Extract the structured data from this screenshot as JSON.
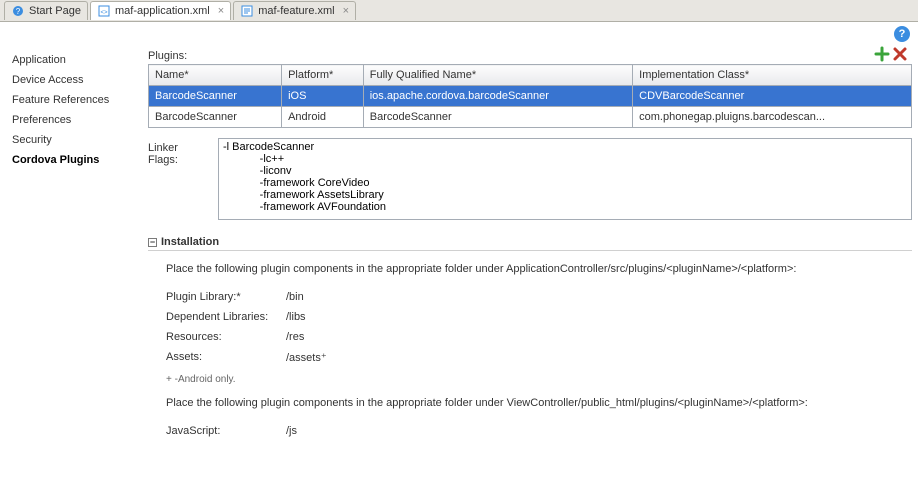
{
  "tabs": [
    {
      "label": "Start Page",
      "icon": "question"
    },
    {
      "label": "maf-application.xml",
      "icon": "xml-app"
    },
    {
      "label": "maf-feature.xml",
      "icon": "xml-feat"
    }
  ],
  "side_nav": {
    "items": [
      "Application",
      "Device Access",
      "Feature References",
      "Preferences",
      "Security",
      "Cordova Plugins"
    ],
    "active_index": 5
  },
  "plugins": {
    "label": "Plugins:",
    "columns": [
      "Name*",
      "Platform*",
      "Fully Qualified Name*",
      "Implementation Class*"
    ],
    "rows": [
      {
        "name": "BarcodeScanner",
        "platform": "iOS",
        "fqn": "ios.apache.cordova.barcodeScanner",
        "impl": "CDVBarcodeScanner",
        "selected": true
      },
      {
        "name": "BarcodeScanner",
        "platform": "Android",
        "fqn": "BarcodeScanner",
        "impl": "com.phonegap.pluigns.barcodescan...",
        "selected": false
      }
    ]
  },
  "linker": {
    "label": "Linker Flags:",
    "value": "-l BarcodeScanner\n            -lc++\n            -liconv\n            -framework CoreVideo\n            -framework AssetsLibrary\n            -framework AVFoundation"
  },
  "installation": {
    "header": "Installation",
    "intro1": "Place the following plugin components in the appropriate folder under ApplicationController/src/plugins/<pluginName>/<platform>:",
    "pairs1": [
      {
        "k": "Plugin Library:*",
        "v": "/bin"
      },
      {
        "k": "Dependent Libraries:",
        "v": "/libs"
      },
      {
        "k": "Resources:",
        "v": "/res"
      },
      {
        "k": "Assets:",
        "v": "/assets⁺"
      }
    ],
    "footnote": "+ -Android only.",
    "intro2": "Place the following plugin components in the appropriate folder under ViewController/public_html/plugins/<pluginName>/<platform>:",
    "pairs2": [
      {
        "k": "JavaScript:",
        "v": "/js"
      }
    ]
  }
}
